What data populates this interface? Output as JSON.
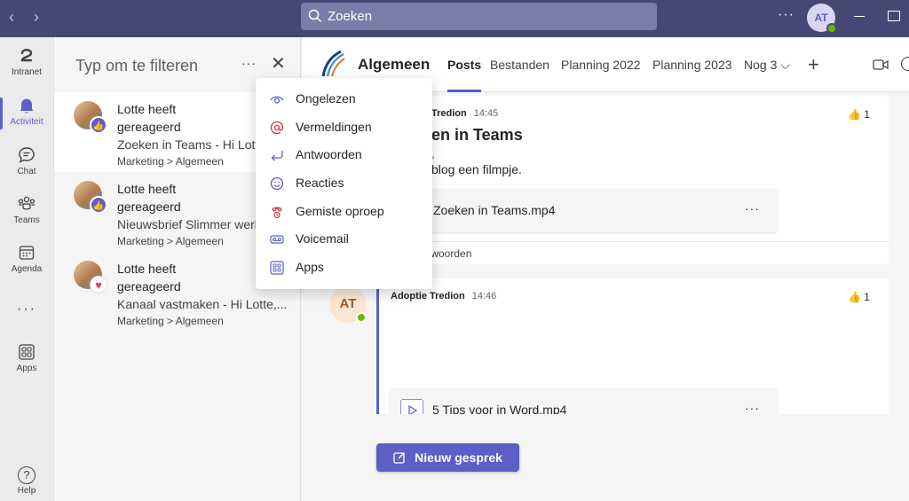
{
  "topbar": {
    "search_placeholder": "Zoeken",
    "more_label": "···",
    "user_initials": "AT"
  },
  "rail": {
    "items": [
      {
        "label": "Intranet",
        "icon": "intranet-icon"
      },
      {
        "label": "Activiteit",
        "icon": "bell-icon",
        "active": true
      },
      {
        "label": "Chat",
        "icon": "chat-icon"
      },
      {
        "label": "Teams",
        "icon": "teams-icon"
      },
      {
        "label": "Agenda",
        "icon": "calendar-icon"
      },
      {
        "label": "Apps",
        "icon": "apps-icon"
      }
    ],
    "more_label": "···",
    "help_label": "Help",
    "help_glyph": "?"
  },
  "activity": {
    "filter_placeholder": "Typ om te filteren",
    "more_label": "···",
    "close_label": "✕",
    "feed": [
      {
        "title1": "Lotte heeft",
        "title2": "gereageerd",
        "preview": "Zoeken in Teams - Hi Lotte,",
        "path": "Marketing > Algemeen",
        "reaction": "like"
      },
      {
        "title1": "Lotte heeft",
        "title2": "gereageerd",
        "preview": "Nieuwsbrief Slimmer werken",
        "path": "Marketing > Algemeen",
        "reaction": "like"
      },
      {
        "title1": "Lotte heeft",
        "title2": "gereageerd",
        "preview": "Kanaal vastmaken - Hi Lotte,...",
        "path": "Marketing > Algemeen",
        "reaction": "heart"
      }
    ]
  },
  "filter_menu": {
    "items": [
      {
        "label": "Ongelezen",
        "icon": "eye-icon"
      },
      {
        "label": "Vermeldingen",
        "icon": "at-icon"
      },
      {
        "label": "Antwoorden",
        "icon": "reply-icon"
      },
      {
        "label": "Reacties",
        "icon": "smile-icon"
      },
      {
        "label": "Gemiste oproep",
        "icon": "missed-call-icon"
      },
      {
        "label": "Voicemail",
        "icon": "voicemail-icon"
      },
      {
        "label": "Apps",
        "icon": "apps-icon"
      }
    ]
  },
  "channel": {
    "name": "Algemeen",
    "tabs": [
      "Posts",
      "Bestanden",
      "Planning 2022",
      "Planning 2023",
      "Nog 3 ⌵"
    ],
    "add_tab": "+",
    "posts": [
      {
        "author_partial": "Tredion",
        "time": "14:45",
        "reaction_count": "1",
        "title_partial": "en in Teams",
        "greeting_partial": ",",
        "body_partial": "blog een filmpje.",
        "attachment": "Zoeken in Teams.mp4",
        "attachment_more": "···",
        "replies_partial": "twoorden"
      },
      {
        "author": "Adoptie Tredion",
        "time": "14:46",
        "reaction_count": "1",
        "avatar": "AT",
        "attachment": "5 Tips voor in Word.mp4",
        "attachment_more": "···"
      }
    ],
    "new_conversation": "Nieuw gesprek"
  },
  "colors": {
    "brand": "#5b5fc7",
    "topbar": "#464775",
    "presence": "#6bb700"
  }
}
